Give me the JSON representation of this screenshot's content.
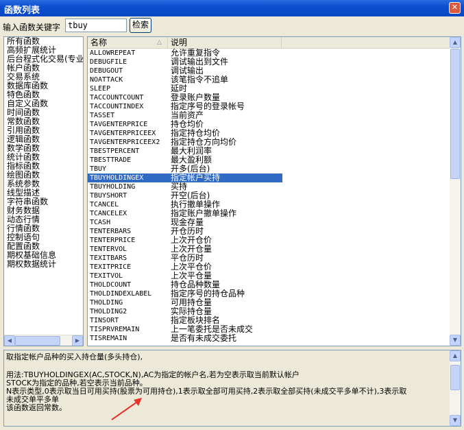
{
  "window": {
    "title": "函数列表",
    "close_glyph": "✕"
  },
  "search": {
    "label": "输入函数关键字",
    "value": "tbuy",
    "button_label": "检索"
  },
  "categories": [
    "所有函数",
    "高频扩展统计",
    "后台程式化交易(专业",
    "帐户函数",
    "交易系统",
    "数据库函数",
    "特色函数",
    "自定义函数",
    "时间函数",
    "常数函数",
    "引用函数",
    "逻辑函数",
    "数学函数",
    "统计函数",
    "指标函数",
    "绘图函数",
    "系统参数",
    "线型描述",
    "字符串函数",
    "财务数据",
    "动态行情",
    "行情函数",
    "控制语句",
    "配置函数",
    "期权基础信息",
    "期权数据统计"
  ],
  "function_list": {
    "columns": [
      "名称",
      "说明"
    ],
    "sort_glyph": "△",
    "selected_index": 14,
    "rows": [
      [
        "ALLOWREPEAT",
        "允许重复指令"
      ],
      [
        "DEBUGFILE",
        "调试输出到文件"
      ],
      [
        "DEBUGOUT",
        "调试输出"
      ],
      [
        "NOATTACK",
        "该笔指令不追单"
      ],
      [
        "SLEEP",
        "延时"
      ],
      [
        "TACCOUNTCOUNT",
        "登录账户数量"
      ],
      [
        "TACCOUNTINDEX",
        "指定序号的登录帐号"
      ],
      [
        "TASSET",
        "当前资产"
      ],
      [
        "TAVGENTERPRICE",
        "持仓均价"
      ],
      [
        "TAVGENTERPRICEEX",
        "指定持仓均价"
      ],
      [
        "TAVGENTERPRICEEX2",
        "指定持仓方向均价"
      ],
      [
        "TBESTPERCENT",
        "最大利润率"
      ],
      [
        "TBESTTRADE",
        "最大盈利额"
      ],
      [
        "TBUY",
        "开多(后台)"
      ],
      [
        "TBUYHOLDINGEX",
        "指定帐户买持"
      ],
      [
        "TBUYHOLDING",
        "买持"
      ],
      [
        "TBUYSHORT",
        "开空(后台)"
      ],
      [
        "TCANCEL",
        "执行撤单操作"
      ],
      [
        "TCANCELEX",
        "指定账户撤单操作"
      ],
      [
        "TCASH",
        "现金存量"
      ],
      [
        "TENTERBARS",
        "开仓历时"
      ],
      [
        "TENTERPRICE",
        "上次开仓价"
      ],
      [
        "TENTERVOL",
        "上次开仓量"
      ],
      [
        "TEXITBARS",
        "平仓历时"
      ],
      [
        "TEXITPRICE",
        "上次平仓价"
      ],
      [
        "TEXITVOL",
        "上次平仓量"
      ],
      [
        "THOLDCOUNT",
        "持仓品种数量"
      ],
      [
        "THOLDINDEXLABEL",
        "指定序号的持仓品种"
      ],
      [
        "THOLDING",
        "可用持仓量"
      ],
      [
        "THOLDING2",
        "实际持仓量"
      ],
      [
        "TINSORT",
        "指定板块排名"
      ],
      [
        "TISPRVREMAIN",
        "上一笔委托是否未成交"
      ],
      [
        "TISREMAIN",
        "是否有未成交委托"
      ]
    ]
  },
  "description": {
    "lines": [
      "取指定帐户品种的买入持仓量(多头持仓),",
      "",
      "用法:TBUYHOLDINGEX(AC,STOCK,N),AC为指定的帐户名,若为空表示取当前默认帐户",
      "STOCK为指定的品种,若空表示当前品种。",
      "N表示类型,0表示取当日可用买持(股票为可用持仓),1表示取全部可用买持,2表示取全部买持(未成交平多单不计),3表示取",
      "未成交单平多单",
      "该函数返回常数。"
    ]
  },
  "annotation": {
    "arrow_color": "#e8322a"
  }
}
